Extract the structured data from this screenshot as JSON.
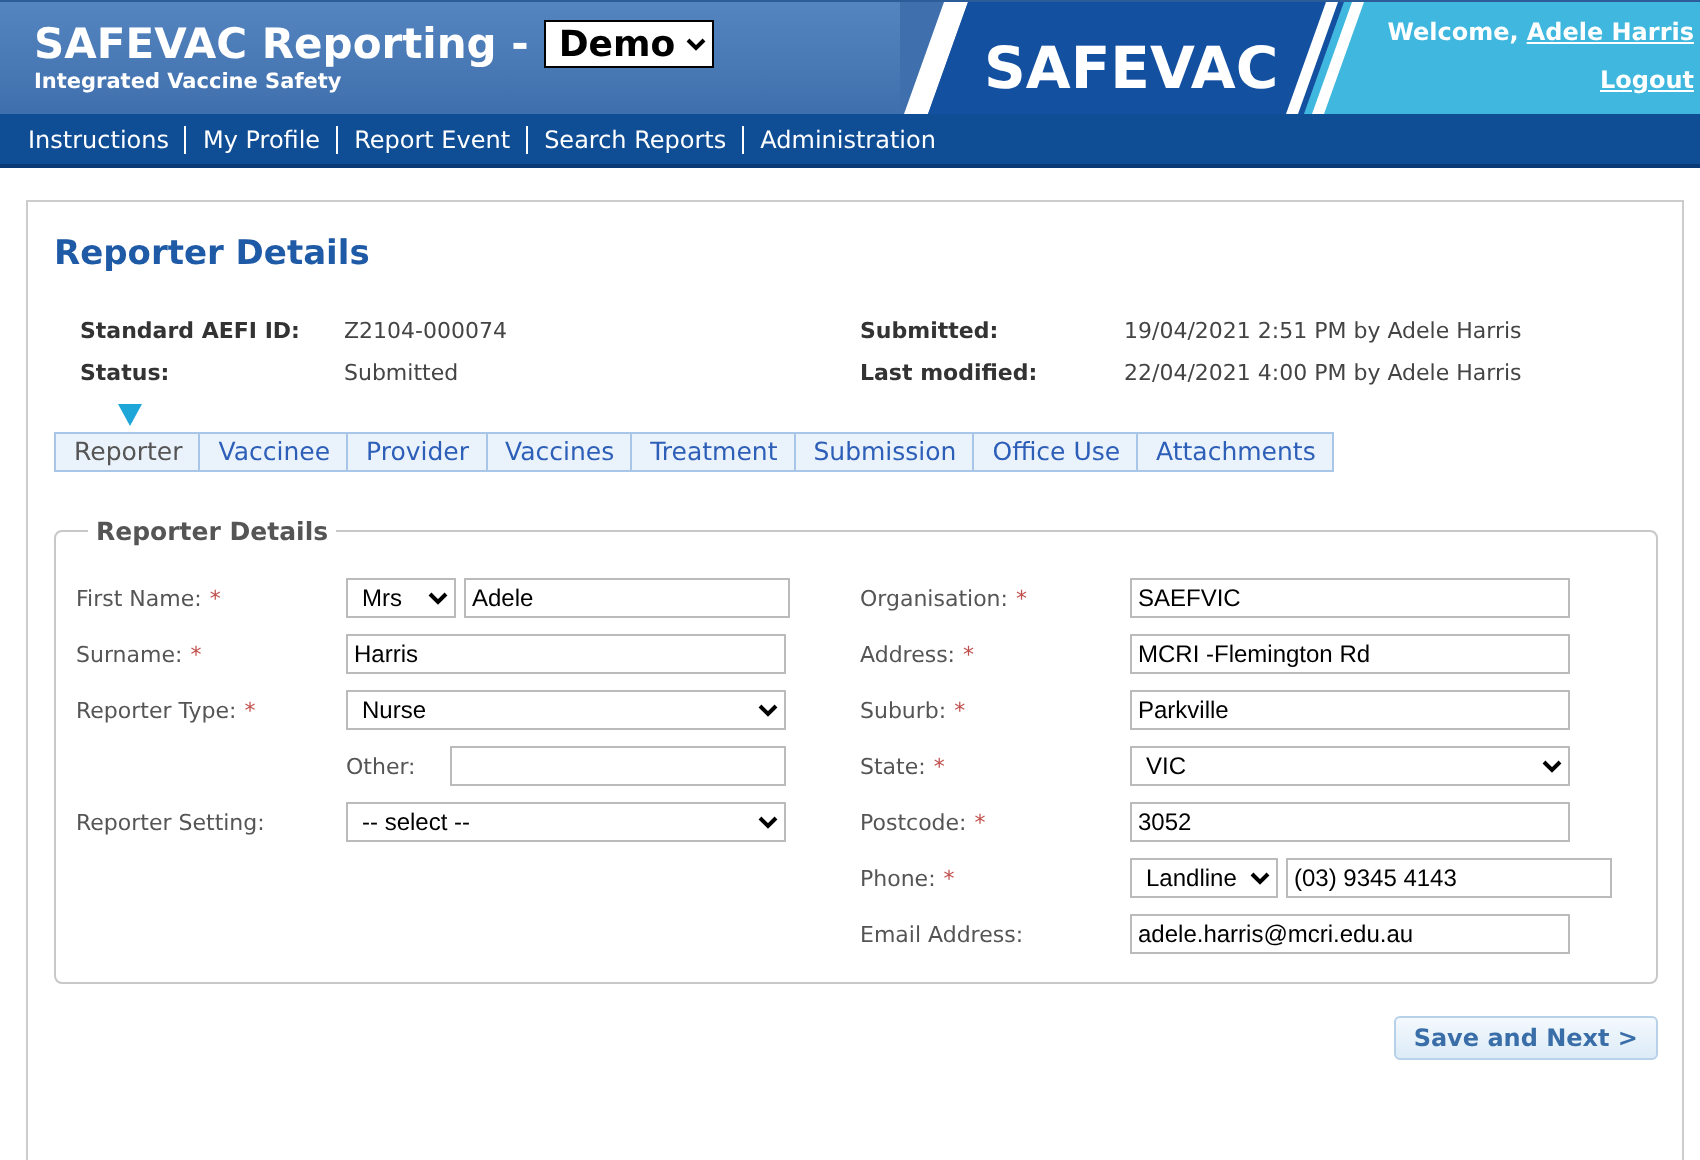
{
  "header": {
    "title": "SAFEVAC Reporting -",
    "mode": "Demo",
    "subtitle": "Integrated Vaccine Safety",
    "logo": "SAFEVAC",
    "welcome": "Welcome,",
    "user": "Adele Harris",
    "logout": "Logout"
  },
  "nav": [
    "Instructions",
    "My Profile",
    "Report Event",
    "Search Reports",
    "Administration"
  ],
  "page_title": "Reporter Details",
  "info": [
    {
      "label": "Standard AEFI ID:",
      "value": "Z2104-000074"
    },
    {
      "label": "Submitted:",
      "value": "19/04/2021 2:51 PM by Adele Harris"
    },
    {
      "label": "Status:",
      "value": "Submitted"
    },
    {
      "label": "Last modified:",
      "value": "22/04/2021 4:00 PM by Adele Harris"
    }
  ],
  "tabs": [
    {
      "label": "Reporter",
      "selected": true
    },
    {
      "label": "Vaccinee",
      "selected": false
    },
    {
      "label": "Provider",
      "selected": false
    },
    {
      "label": "Vaccines",
      "selected": false
    },
    {
      "label": "Treatment",
      "selected": false
    },
    {
      "label": "Submission",
      "selected": false
    },
    {
      "label": "Office Use",
      "selected": false
    },
    {
      "label": "Attachments",
      "selected": false
    }
  ],
  "form": {
    "legend": "Reporter Details",
    "left_fields": [
      {
        "kind": "select_text",
        "label": "First Name:",
        "required_mark": "*",
        "option": "Mrs",
        "value": "Adele"
      },
      {
        "kind": "text",
        "label": "Surname:",
        "required_mark": "*",
        "value": "Harris"
      },
      {
        "kind": "select",
        "label": "Reporter Type:",
        "required_mark": "*",
        "value": "Nurse"
      },
      {
        "kind": "other",
        "label": "Other:"
      },
      {
        "kind": "select",
        "label": "Reporter Setting:",
        "value": "-- select --"
      }
    ],
    "right_fields": [
      {
        "kind": "text",
        "label": "Organisation:",
        "required_mark": "*",
        "value": "SAEFVIC"
      },
      {
        "kind": "text",
        "label": "Address:",
        "required_mark": "*",
        "value": "MCRI -Flemington Rd"
      },
      {
        "kind": "text",
        "label": "Suburb:",
        "required_mark": "*",
        "value": "Parkville"
      },
      {
        "kind": "select",
        "label": "State:",
        "required_mark": "*",
        "value": "VIC"
      },
      {
        "kind": "text",
        "label": "Postcode:",
        "required_mark": "*",
        "value": "3052"
      },
      {
        "kind": "select_text",
        "label": "Phone:",
        "required_mark": "*",
        "option": "Landline",
        "value": "(03) 9345 4143"
      },
      {
        "kind": "text",
        "label": "Email Address:",
        "value": "adele.harris@mcri.edu.au"
      }
    ]
  },
  "button": "Save and Next >"
}
